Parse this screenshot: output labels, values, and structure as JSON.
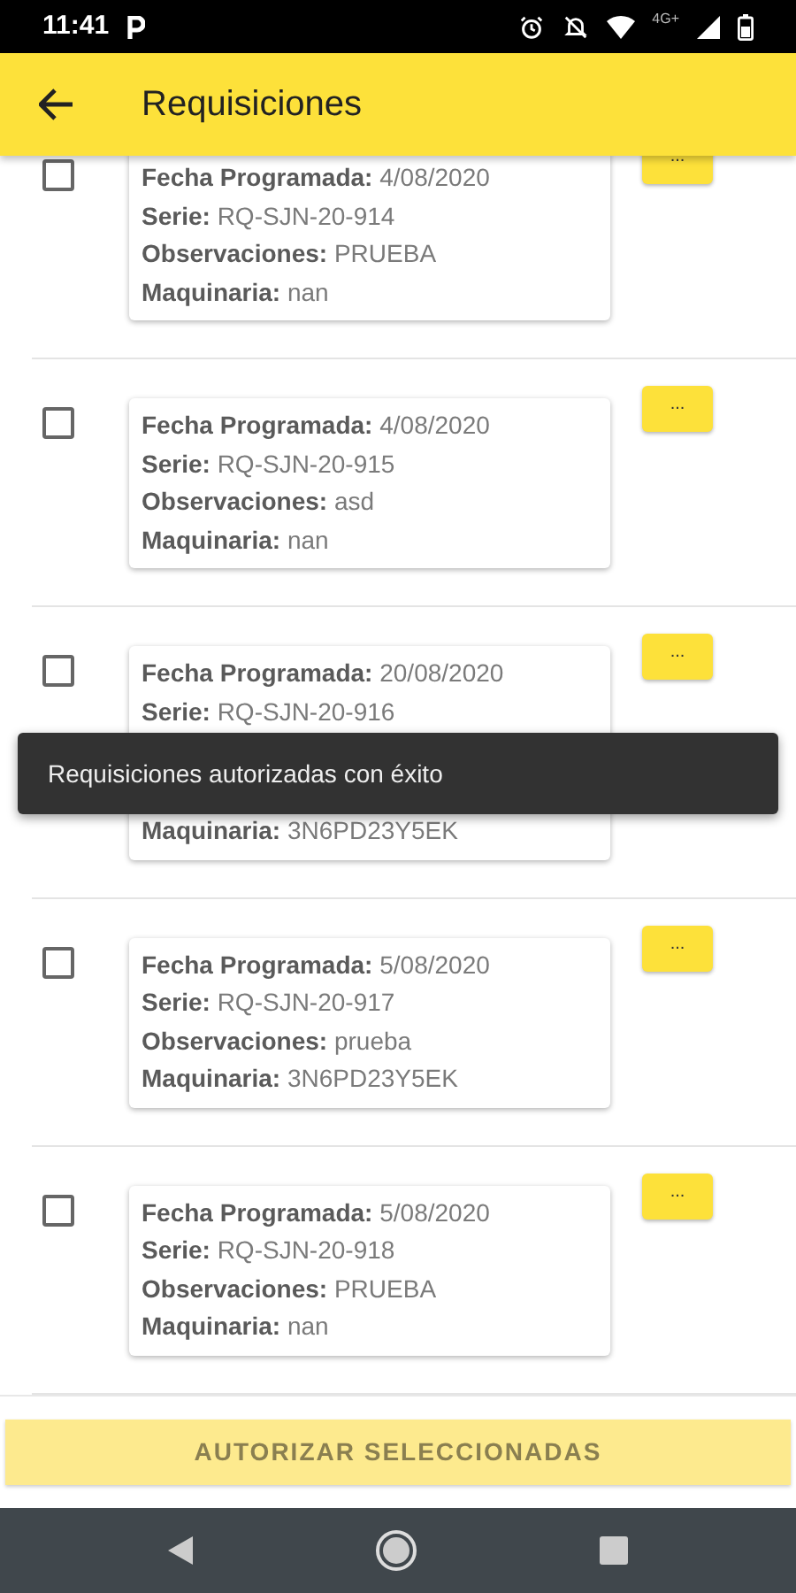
{
  "status_bar": {
    "time": "11:41",
    "network_label": "4G+"
  },
  "app_bar": {
    "title": "Requisiciones"
  },
  "requisitions": [
    {
      "checked": false,
      "button": "...",
      "fields": [
        {
          "label": "Fecha Programada:",
          "value": "4/08/2020"
        },
        {
          "label": "Serie:",
          "value": "RQ-SJN-20-914"
        },
        {
          "label": "Observaciones:",
          "value": "PRUEBA"
        },
        {
          "label": "Maquinaria:",
          "value": "nan"
        }
      ]
    },
    {
      "checked": false,
      "button": "...",
      "fields": [
        {
          "label": "Fecha Programada:",
          "value": "4/08/2020"
        },
        {
          "label": "Serie:",
          "value": "RQ-SJN-20-915"
        },
        {
          "label": "Observaciones:",
          "value": "asd"
        },
        {
          "label": "Maquinaria:",
          "value": "nan"
        }
      ]
    },
    {
      "checked": false,
      "button": "...",
      "fields": [
        {
          "label": "Fecha Programada:",
          "value": "20/08/2020"
        },
        {
          "label": "Serie:",
          "value": "RQ-SJN-20-916"
        },
        {
          "kind": "covered"
        },
        {
          "label": "Maquinaria:",
          "value": "3N6PD23Y5EK"
        }
      ]
    },
    {
      "checked": false,
      "button": "...",
      "fields": [
        {
          "label": "Fecha Programada:",
          "value": "5/08/2020"
        },
        {
          "label": "Serie:",
          "value": "RQ-SJN-20-917"
        },
        {
          "label": "Observaciones:",
          "value": "prueba"
        },
        {
          "label": "Maquinaria:",
          "value": "3N6PD23Y5EK"
        }
      ]
    },
    {
      "checked": false,
      "button": "...",
      "fields": [
        {
          "label": "Fecha Programada:",
          "value": "5/08/2020"
        },
        {
          "label": "Serie:",
          "value": "RQ-SJN-20-918"
        },
        {
          "label": "Observaciones:",
          "value": "PRUEBA"
        },
        {
          "label": "Maquinaria:",
          "value": "nan"
        }
      ]
    }
  ],
  "toast": {
    "message": "Requisiciones autorizadas con éxito"
  },
  "authorize_button": {
    "label": "AUTORIZAR SELECCIONADAS"
  }
}
